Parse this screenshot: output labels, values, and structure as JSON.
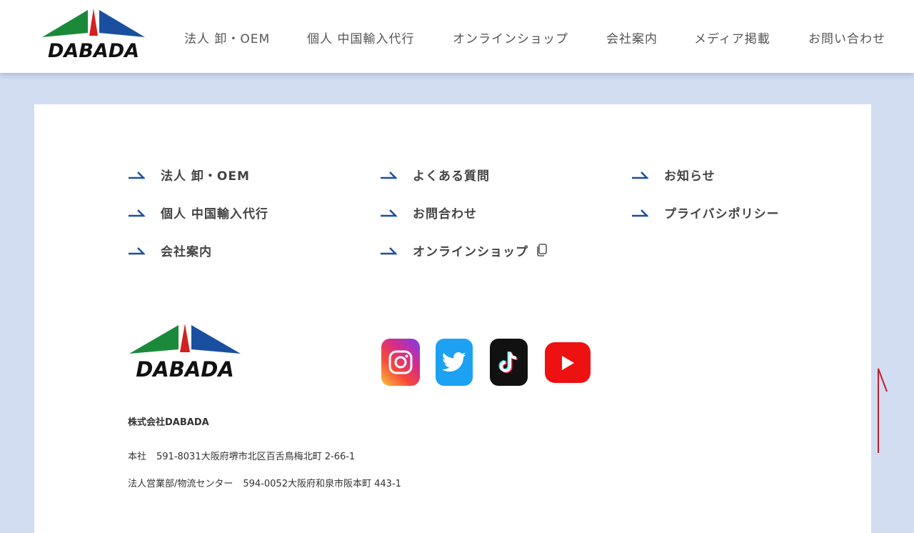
{
  "header": {
    "logo_text": "DABADA",
    "nav": [
      {
        "label": "法人 卸・OEM"
      },
      {
        "label": "個人 中国輸入代行"
      },
      {
        "label": "オンラインショップ"
      },
      {
        "label": "会社案内"
      },
      {
        "label": "メディア掲載"
      },
      {
        "label": "お問い合わせ"
      }
    ]
  },
  "footer": {
    "links": [
      {
        "label": "法人 卸・OEM"
      },
      {
        "label": "個人 中国輸入代行"
      },
      {
        "label": "会社案内"
      },
      {
        "label": "よくある質問"
      },
      {
        "label": "お問合わせ"
      },
      {
        "label": "オンラインショップ"
      },
      {
        "label": "お知らせ"
      },
      {
        "label": "プライバシポリシー"
      }
    ],
    "logo_text": "DABADA",
    "company_name": "株式会社DABADA",
    "address_hq_label": "本社",
    "address_hq": "591-8031大阪府堺市北区百舌鳥梅北町 2-66-1",
    "address_center_label": "法人営業部/物流センター",
    "address_center": "594-0052大阪府和泉市阪本町 443-1",
    "social": [
      {
        "icon": "instagram-icon"
      },
      {
        "icon": "twitter-icon"
      },
      {
        "icon": "tiktok-icon"
      },
      {
        "icon": "youtube-icon"
      }
    ]
  },
  "colors": {
    "page_bg": "#d3ddf2",
    "accent_blue": "#1a4fa0",
    "logo_green": "#1a8a3a",
    "logo_red": "#d42020"
  }
}
